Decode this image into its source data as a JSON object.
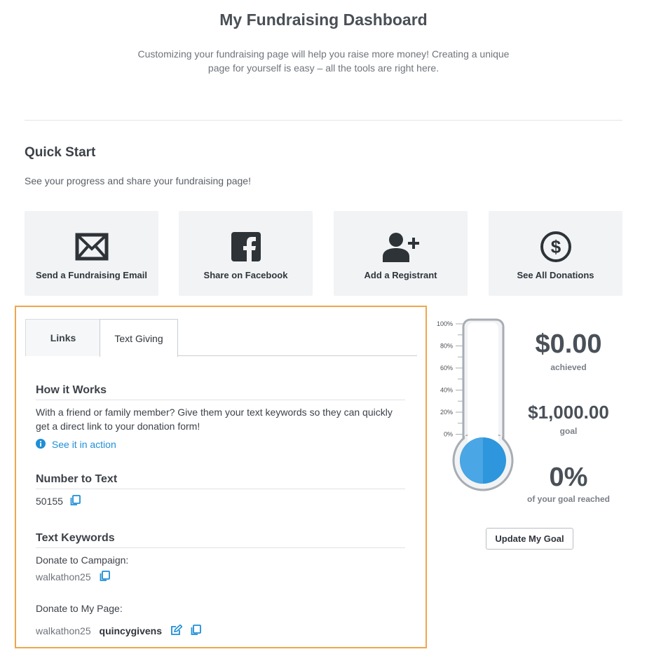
{
  "header": {
    "title": "My Fundraising Dashboard",
    "intro": "Customizing your fundraising page will help you raise more money! Creating a unique page for yourself is easy – all the tools are right here."
  },
  "quick_start": {
    "title": "Quick Start",
    "subtitle": "See your progress and share your fundraising page!",
    "cards": [
      {
        "label": "Send a Fundraising Email",
        "icon": "envelope-icon"
      },
      {
        "label": "Share on Facebook",
        "icon": "facebook-icon"
      },
      {
        "label": "Add a Registrant",
        "icon": "add-user-icon"
      },
      {
        "label": "See All Donations",
        "icon": "dollar-circle-icon"
      }
    ]
  },
  "tabs": {
    "links": "Links",
    "text_giving": "Text Giving",
    "active": "Text Giving"
  },
  "text_giving": {
    "how_title": "How it Works",
    "how_body": "With a friend or family member? Give them your text keywords so they can quickly get a direct link to your donation form!",
    "see_action": "See it in action",
    "number_title": "Number to Text",
    "number": "50155",
    "keywords_title": "Text Keywords",
    "campaign_label": "Donate to Campaign:",
    "campaign_keyword": "walkathon25",
    "page_label": "Donate to My Page:",
    "page_keyword": "walkathon25",
    "page_handle": "quincygivens"
  },
  "progress": {
    "scale": [
      "100%",
      "80%",
      "60%",
      "40%",
      "20%",
      "0%"
    ],
    "achieved_value": "$0.00",
    "achieved_label": "achieved",
    "goal_value": "$1,000.00",
    "goal_label": "goal",
    "percent_value": "0%",
    "percent_label": "of your goal reached",
    "fill_fraction": 0,
    "update_button": "Update My Goal"
  },
  "colors": {
    "highlight_border": "#f0a64b",
    "link": "#1f8fd6",
    "thermo_blue": "#1a8fdd"
  }
}
